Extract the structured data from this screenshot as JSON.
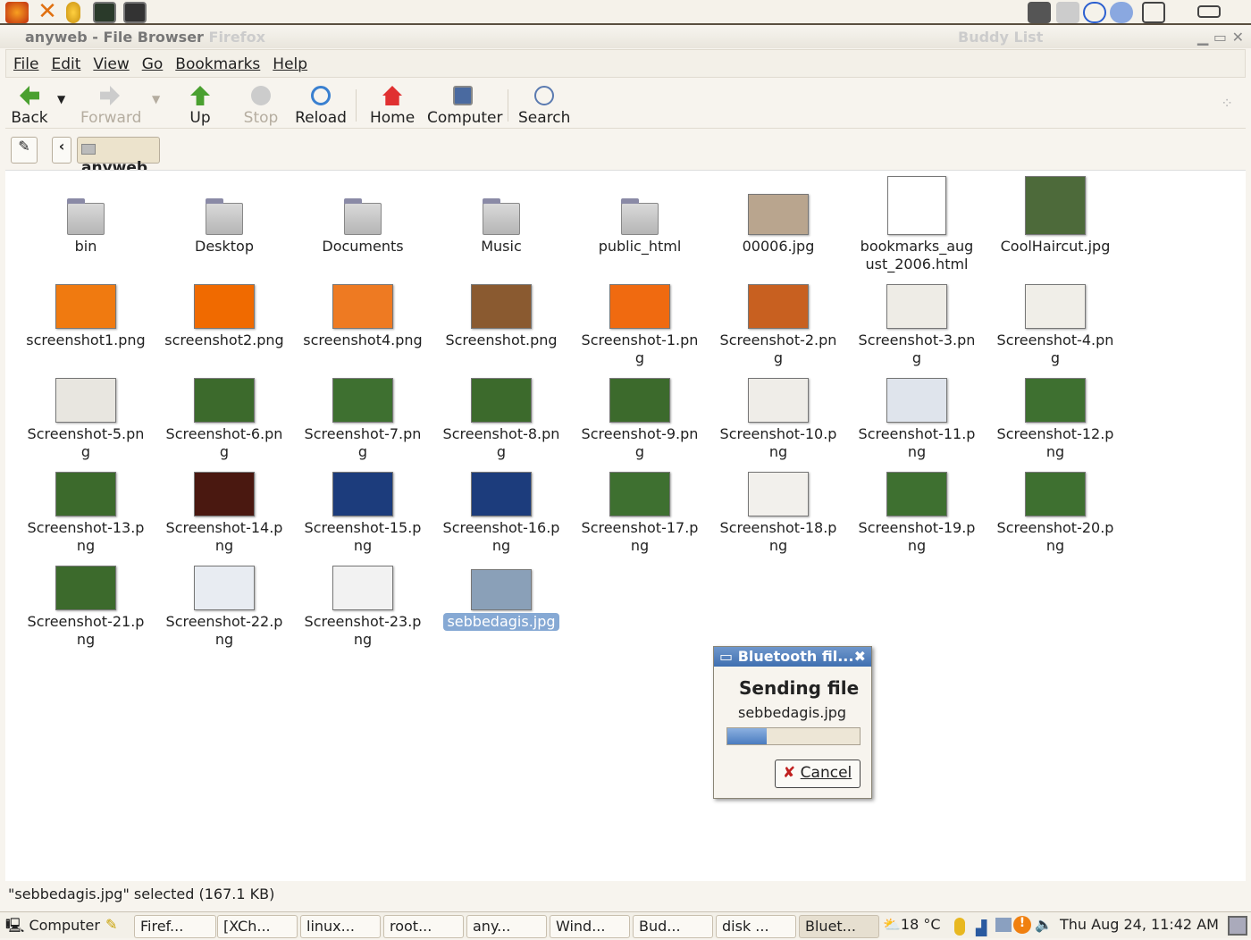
{
  "launchers": [
    "firefox-icon",
    "xchat-icon",
    "buddy-icon",
    "terminal-icon",
    "root-terminal-icon"
  ],
  "window": {
    "title": "anyweb - File Browser",
    "ghost_title": "Firefox",
    "ghost_right": "Buddy List"
  },
  "menu": [
    "File",
    "Edit",
    "View",
    "Go",
    "Bookmarks",
    "Help"
  ],
  "toolbar": {
    "back": "Back",
    "forward": "Forward",
    "up": "Up",
    "stop": "Stop",
    "reload": "Reload",
    "home": "Home",
    "computer": "Computer",
    "search": "Search"
  },
  "location": {
    "current": "anyweb"
  },
  "items": [
    {
      "name": "bin",
      "kind": "folder"
    },
    {
      "name": "Desktop",
      "kind": "folder"
    },
    {
      "name": "Documents",
      "kind": "folder"
    },
    {
      "name": "Music",
      "kind": "folder"
    },
    {
      "name": "public_html",
      "kind": "folder"
    },
    {
      "name": "00006.jpg",
      "kind": "photo",
      "color": "#b9a58e"
    },
    {
      "name": "bookmarks_aug\nust_2006.html",
      "kind": "doc",
      "color": "#ffffff"
    },
    {
      "name": "CoolHaircut.jpg",
      "kind": "photo",
      "color": "#4d6a3a"
    },
    {
      "name": "screenshot1.png",
      "color": "#f07a10"
    },
    {
      "name": "screenshot2.png",
      "color": "#f06a00"
    },
    {
      "name": "screenshot4.png",
      "color": "#ee7a22"
    },
    {
      "name": "Screenshot.png",
      "color": "#8a5a30"
    },
    {
      "name": "Screenshot-1.pn\ng",
      "color": "#f06a10"
    },
    {
      "name": "Screenshot-2.pn\ng",
      "color": "#c86020"
    },
    {
      "name": "Screenshot-3.pn\ng",
      "color": "#eeece6"
    },
    {
      "name": "Screenshot-4.pn\ng",
      "color": "#f0eee8"
    },
    {
      "name": "Screenshot-5.pn\ng",
      "color": "#e8e6e0"
    },
    {
      "name": "Screenshot-6.pn\ng",
      "color": "#3c6a2c"
    },
    {
      "name": "Screenshot-7.pn\ng",
      "color": "#3e7030"
    },
    {
      "name": "Screenshot-8.pn\ng",
      "color": "#3c6a2c"
    },
    {
      "name": "Screenshot-9.pn\ng",
      "color": "#3c6a2c"
    },
    {
      "name": "Screenshot-10.p\nng",
      "color": "#efede8"
    },
    {
      "name": "Screenshot-11.p\nng",
      "color": "#dfe4ec"
    },
    {
      "name": "Screenshot-12.p\nng",
      "color": "#3e7030"
    },
    {
      "name": "Screenshot-13.p\nng",
      "color": "#3c6a2c"
    },
    {
      "name": "Screenshot-14.p\nng",
      "color": "#4a1810"
    },
    {
      "name": "Screenshot-15.p\nng",
      "color": "#1c3c7c"
    },
    {
      "name": "Screenshot-16.p\nng",
      "color": "#1c3c7c"
    },
    {
      "name": "Screenshot-17.p\nng",
      "color": "#3e7030"
    },
    {
      "name": "Screenshot-18.p\nng",
      "color": "#f2f0ec"
    },
    {
      "name": "Screenshot-19.p\nng",
      "color": "#3e7030"
    },
    {
      "name": "Screenshot-20.p\nng",
      "color": "#3e7030"
    },
    {
      "name": "Screenshot-21.p\nng",
      "color": "#3c6a2c"
    },
    {
      "name": "Screenshot-22.p\nng",
      "color": "#e8ecf2"
    },
    {
      "name": "Screenshot-23.p\nng",
      "color": "#f2f2f2"
    },
    {
      "name": "sebbedagis.jpg",
      "kind": "photo",
      "color": "#8aa0b8",
      "selected": true
    }
  ],
  "status": "\"sebbedagis.jpg\" selected (167.1 KB)",
  "dialog": {
    "title": "Bluetooth fil...",
    "heading": "Sending file",
    "file": "sebbedagis.jpg",
    "progress": 0.3,
    "cancel": "Cancel"
  },
  "taskbar": {
    "show_desktop": "Computer",
    "tasks": [
      "Firef...",
      "[XCh...",
      "linux...",
      "root...",
      "any...",
      "Wind...",
      "Bud...",
      "disk ...",
      "Bluet..."
    ],
    "active": 8,
    "weather": "18 °C",
    "clock": "Thu Aug 24, 11:42 AM"
  }
}
